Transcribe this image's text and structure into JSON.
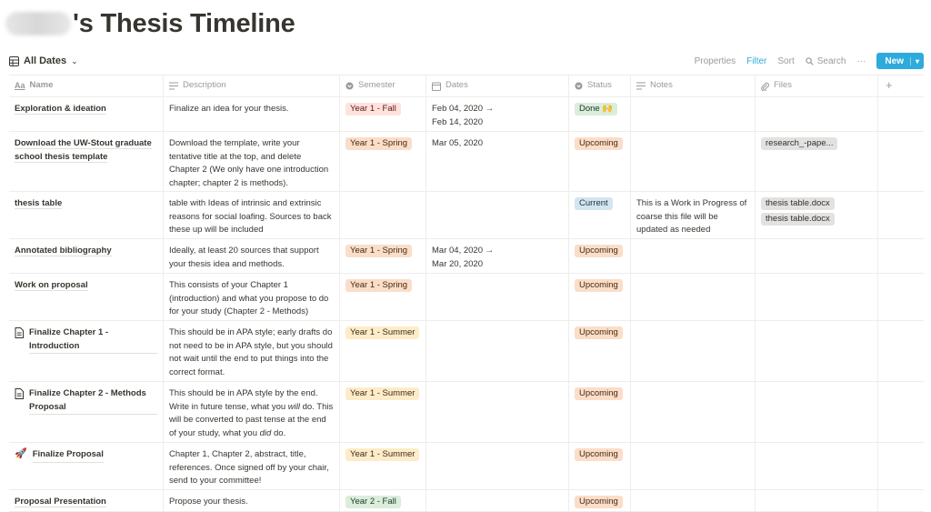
{
  "page": {
    "title": "'s Thesis Timeline"
  },
  "toolbar": {
    "view_label": "All Dates",
    "properties": "Properties",
    "filter": "Filter",
    "sort": "Sort",
    "search": "Search",
    "more": "···",
    "new": "New"
  },
  "columns": {
    "name": "Name",
    "description": "Description",
    "semester": "Semester",
    "dates": "Dates",
    "status": "Status",
    "notes": "Notes",
    "files": "Files",
    "add": "+"
  },
  "rows": [
    {
      "name": "Exploration & ideation",
      "desc": "Finalize an idea for your thesis.",
      "semester": "Year 1 - Fall",
      "date1": "Feb 04, 2020 →",
      "date2": "Feb 14, 2020",
      "status": "Done 🙌",
      "notes": "",
      "file1": "",
      "file2": ""
    },
    {
      "name": "Download the UW-Stout graduate school thesis template",
      "desc": "Download the template, write your tentative title at the top, and delete Chapter 2 (We only have one introduction chapter; chapter 2 is methods).",
      "semester": "Year 1 - Spring",
      "date1": "Mar 05, 2020",
      "date2": "",
      "status": "Upcoming",
      "notes": "",
      "file1": "research_-pape...",
      "file2": ""
    },
    {
      "name": "thesis table",
      "desc": "table with Ideas of intrinsic and extrinsic reasons for social loafing. Sources to back these up will be included",
      "semester": "",
      "date1": "",
      "date2": "",
      "status": "Current",
      "notes": "This is a Work in Progress of coarse this file will be updated as needed",
      "file1": "thesis table.docx",
      "file2": "thesis table.docx"
    },
    {
      "name": "Annotated bibliography",
      "desc": "Ideally, at least 20 sources that support your thesis idea and methods.",
      "semester": "Year 1 - Spring",
      "date1": "Mar 04, 2020 →",
      "date2": "Mar 20, 2020",
      "status": "Upcoming",
      "notes": "",
      "file1": "",
      "file2": ""
    },
    {
      "name": "Work on proposal",
      "desc": "This consists of your Chapter 1 (introduction) and what you propose to do for your study (Chapter 2 - Methods)",
      "semester": "Year 1 - Spring",
      "date1": "",
      "date2": "",
      "status": "Upcoming",
      "notes": "",
      "file1": "",
      "file2": ""
    },
    {
      "name": "Finalize Chapter 1 - Introduction",
      "desc": "This should be in APA style; early drafts do not need to be in APA style, but you should not wait until the end to put things into the correct format.",
      "semester": "Year 1 - Summer",
      "date1": "",
      "date2": "",
      "status": "Upcoming",
      "notes": "",
      "file1": "",
      "file2": ""
    },
    {
      "name": "Finalize Chapter 2 - Methods Proposal",
      "desc_a": "This should be in APA style by the end. Write in future tense, what you ",
      "desc_b": "will",
      "desc_c": " do. This will be converted to past tense at the end of your study, what you ",
      "desc_d": "did",
      "desc_e": " do.",
      "semester": "Year 1 - Summer",
      "date1": "",
      "date2": "",
      "status": "Upcoming",
      "notes": "",
      "file1": "",
      "file2": ""
    },
    {
      "name": "Finalize Proposal",
      "desc": "Chapter 1, Chapter 2, abstract, title, references. Once signed off by your chair, send to your committee!",
      "semester": "Year 1 - Summer",
      "date1": "",
      "date2": "",
      "status": "Upcoming",
      "notes": "",
      "file1": "",
      "file2": ""
    },
    {
      "name": "Proposal Presentation",
      "desc": "Propose your thesis.",
      "semester": "Year 2 - Fall",
      "date1": "",
      "date2": "",
      "status": "Upcoming",
      "notes": "",
      "file1": "",
      "file2": ""
    }
  ]
}
